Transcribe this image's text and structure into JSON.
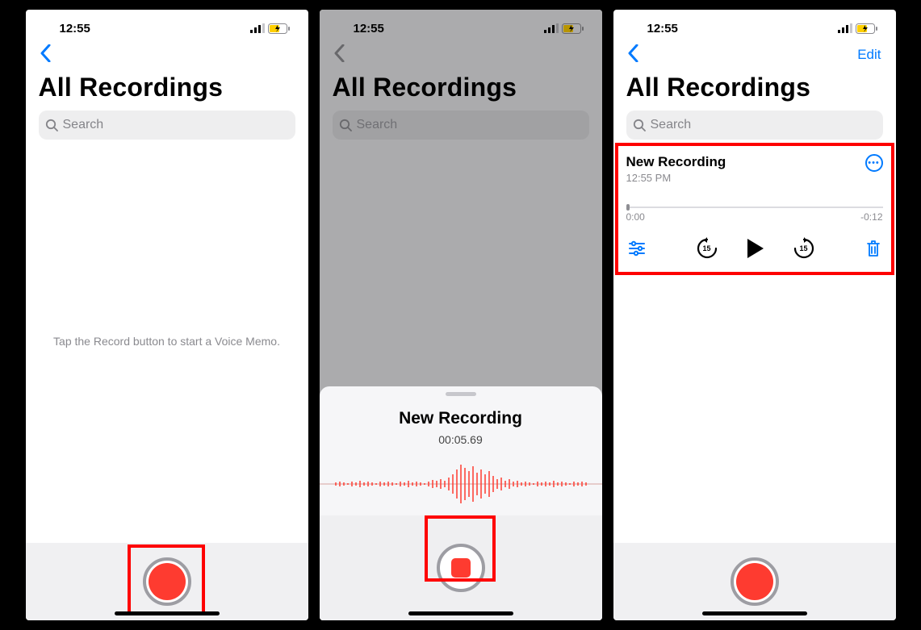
{
  "statusbar": {
    "time": "12:55"
  },
  "screen1": {
    "title": "All Recordings",
    "search_placeholder": "Search",
    "hint": "Tap the Record button to start a Voice Memo."
  },
  "screen2": {
    "title": "All Recordings",
    "search_placeholder": "Search",
    "sheet_title": "New Recording",
    "elapsed": "00:05.69"
  },
  "screen3": {
    "title": "All Recordings",
    "search_placeholder": "Search",
    "edit_label": "Edit",
    "recording": {
      "title": "New Recording",
      "subtitle": "12:55 PM",
      "pos": "0:00",
      "remaining": "-0:12",
      "skip_amount": "15"
    }
  }
}
